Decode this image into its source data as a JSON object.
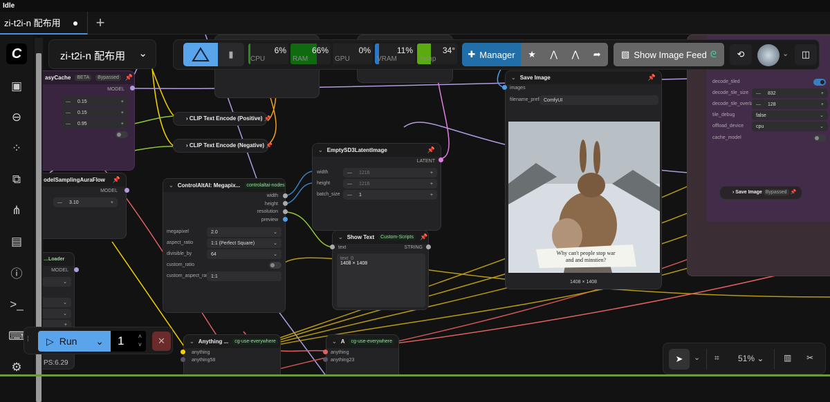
{
  "status": "Idle",
  "tabs": [
    {
      "label": "zi-t2i-n 配布用",
      "modified": true
    }
  ],
  "new_tab": "+",
  "sidebar": {
    "logo": "C",
    "icons": [
      "images-icon",
      "model-library-icon",
      "node-library-icon",
      "workflows-icon",
      "templates-icon",
      "queue-icon",
      "help-icon",
      "terminal-icon",
      "keyboard-icon",
      "settings-icon"
    ]
  },
  "workflow_selector": {
    "label": "zi-t2i-n 配布用"
  },
  "monitor": {
    "cpu": {
      "label": "CPU",
      "value": "6%",
      "pct": 6
    },
    "ram": {
      "label": "RAM",
      "value": "66%",
      "pct": 66
    },
    "gpu": {
      "label": "GPU",
      "value": "0%",
      "pct": 0
    },
    "vram": {
      "label": "VRAM",
      "value": "11%",
      "pct": 11
    },
    "temp": {
      "label": "Temp",
      "value": "34°",
      "pct": 34
    }
  },
  "toolbar": {
    "manager": "Manager",
    "image_feed": "Show Image Feed"
  },
  "nodes": {
    "easycache": {
      "title": "asyCache",
      "beta": "BETA",
      "bypassed": "Bypassed",
      "output": "MODEL",
      "values": [
        "0.15",
        "0.15",
        "0.95"
      ]
    },
    "aura": {
      "title": "odelSamplingAuraFlow",
      "output": "MODEL",
      "value": "3.10"
    },
    "loader": {
      "title": "…Loader",
      "output": "MODEL"
    },
    "clip_pos": {
      "title": "CLIP Text Encode (Positive)"
    },
    "clip_neg": {
      "title": "CLIP Text Encode (Negative)"
    },
    "megapix": {
      "title": "ControlAltAI: Megapix...",
      "badge": "controlaltai-nodes",
      "outputs": [
        "width",
        "height",
        "resolution",
        "preview"
      ],
      "widgets": {
        "megapixel_label": "megapixel",
        "megapixel": "2.0",
        "aspect_label": "aspect_ratio",
        "aspect": "1:1 (Perfect Square)",
        "div_label": "divisible_by",
        "div": "64",
        "custom_label": "custom_ratio",
        "car_label": "custom_aspect_ratio",
        "car": "1:1"
      }
    },
    "latent": {
      "title": "EmptySD3LatentImage",
      "output": "LATENT",
      "w_label": "width",
      "w": "1216",
      "h_label": "height",
      "h": "1216",
      "b_label": "batch_size",
      "b": "1"
    },
    "showtext": {
      "title": "Show Text",
      "badge": "Custom-Scripts",
      "input": "text",
      "output": "STRING",
      "field_label": "text_0",
      "field": "1408 × 1408"
    },
    "save": {
      "title": "Save Image",
      "input": "images",
      "prefix_label": "filename_prefix",
      "prefix": "ComfyUI",
      "caption": "1408 × 1408",
      "image_text_1": "Why can't people stop war",
      "image_text_2": "and and minstien?"
    },
    "vae": {
      "tiled_label": "decode_tiled",
      "size_label": "decode_tile_size",
      "size": "832",
      "overlap_label": "decode_tile_overlap",
      "overlap": "128",
      "debug_label": "tile_debug",
      "debug": "false",
      "offload_label": "offload_device",
      "offload": "cpu",
      "cache_label": "cache_model"
    },
    "save2": {
      "title": "Save Image",
      "bypassed": "Bypassed"
    },
    "anything1": {
      "title": "Anything ...",
      "badge": "cg-use-everywhere",
      "inputs": [
        "anything",
        "anything58"
      ]
    },
    "anything2": {
      "title": "A",
      "badge": "cg-use-everywhere",
      "inputs": [
        "anything",
        "anything23"
      ]
    }
  },
  "run": {
    "label": "Run",
    "count": "1"
  },
  "fps": "PS:6.29",
  "canvas_tools": {
    "zoom": "51%"
  }
}
